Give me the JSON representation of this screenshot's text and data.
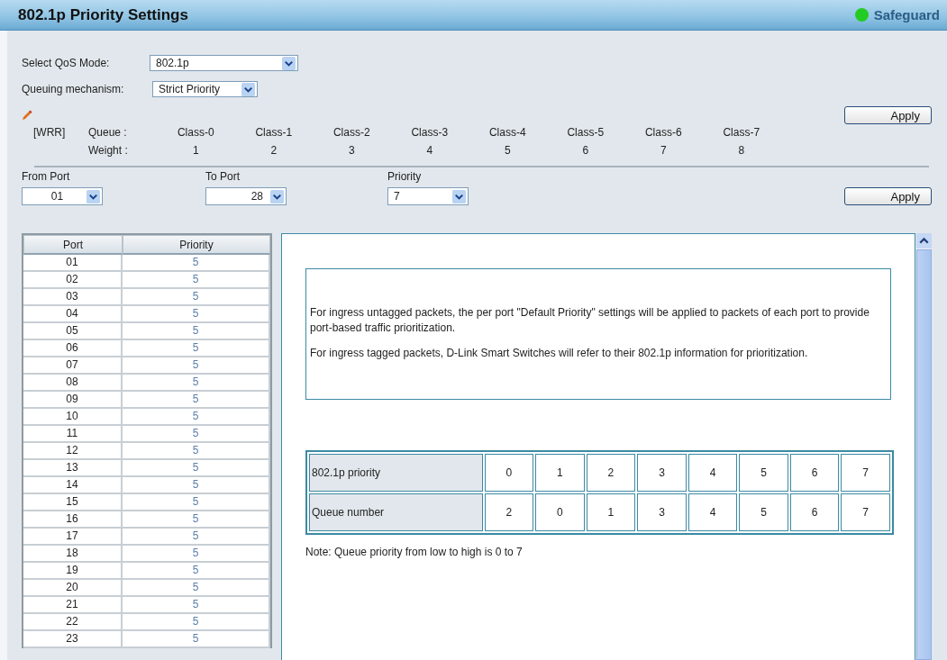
{
  "window": {
    "title": "802.1p Priority Settings",
    "status": "Safeguard"
  },
  "qos_mode": {
    "label": "Select QoS Mode:",
    "value": "802.1p"
  },
  "queuing": {
    "label": "Queuing mechanism:",
    "value": "Strict Priority"
  },
  "apply_top": "Apply",
  "wrr": {
    "tag": "[WRR]",
    "queue_label": "Queue :",
    "weight_label": "Weight :",
    "classes": [
      {
        "queue": "Class-0",
        "weight": "1"
      },
      {
        "queue": "Class-1",
        "weight": "2"
      },
      {
        "queue": "Class-2",
        "weight": "3"
      },
      {
        "queue": "Class-3",
        "weight": "4"
      },
      {
        "queue": "Class-4",
        "weight": "5"
      },
      {
        "queue": "Class-5",
        "weight": "6"
      },
      {
        "queue": "Class-6",
        "weight": "7"
      },
      {
        "queue": "Class-7",
        "weight": "8"
      }
    ]
  },
  "range": {
    "fields": [
      {
        "label": "From Port",
        "value": "01"
      },
      {
        "label": "To Port",
        "value": "28"
      },
      {
        "label": "Priority",
        "value": "7"
      }
    ],
    "apply": "Apply"
  },
  "port_table": {
    "columns": [
      "Port",
      "Priority"
    ],
    "rows": [
      [
        "01",
        "5"
      ],
      [
        "02",
        "5"
      ],
      [
        "03",
        "5"
      ],
      [
        "04",
        "5"
      ],
      [
        "05",
        "5"
      ],
      [
        "06",
        "5"
      ],
      [
        "07",
        "5"
      ],
      [
        "08",
        "5"
      ],
      [
        "09",
        "5"
      ],
      [
        "10",
        "5"
      ],
      [
        "11",
        "5"
      ],
      [
        "12",
        "5"
      ],
      [
        "13",
        "5"
      ],
      [
        "14",
        "5"
      ],
      [
        "15",
        "5"
      ],
      [
        "16",
        "5"
      ],
      [
        "17",
        "5"
      ],
      [
        "18",
        "5"
      ],
      [
        "19",
        "5"
      ],
      [
        "20",
        "5"
      ],
      [
        "21",
        "5"
      ],
      [
        "22",
        "5"
      ],
      [
        "23",
        "5"
      ]
    ]
  },
  "info": {
    "paragraphs": [
      "For ingress untagged packets, the per port \"Default Priority\" settings will be applied to packets of each port to provide port-based traffic prioritization.",
      "For ingress tagged packets, D-Link Smart Switches will refer to their 802.1p information for prioritization."
    ],
    "mapping": [
      {
        "label": "802.1p priority",
        "values": [
          "0",
          "1",
          "2",
          "3",
          "4",
          "5",
          "6",
          "7"
        ]
      },
      {
        "label": "Queue number",
        "values": [
          "2",
          "0",
          "1",
          "3",
          "4",
          "5",
          "6",
          "7"
        ]
      }
    ],
    "note": "Note: Queue priority from low to high is 0 to 7"
  }
}
